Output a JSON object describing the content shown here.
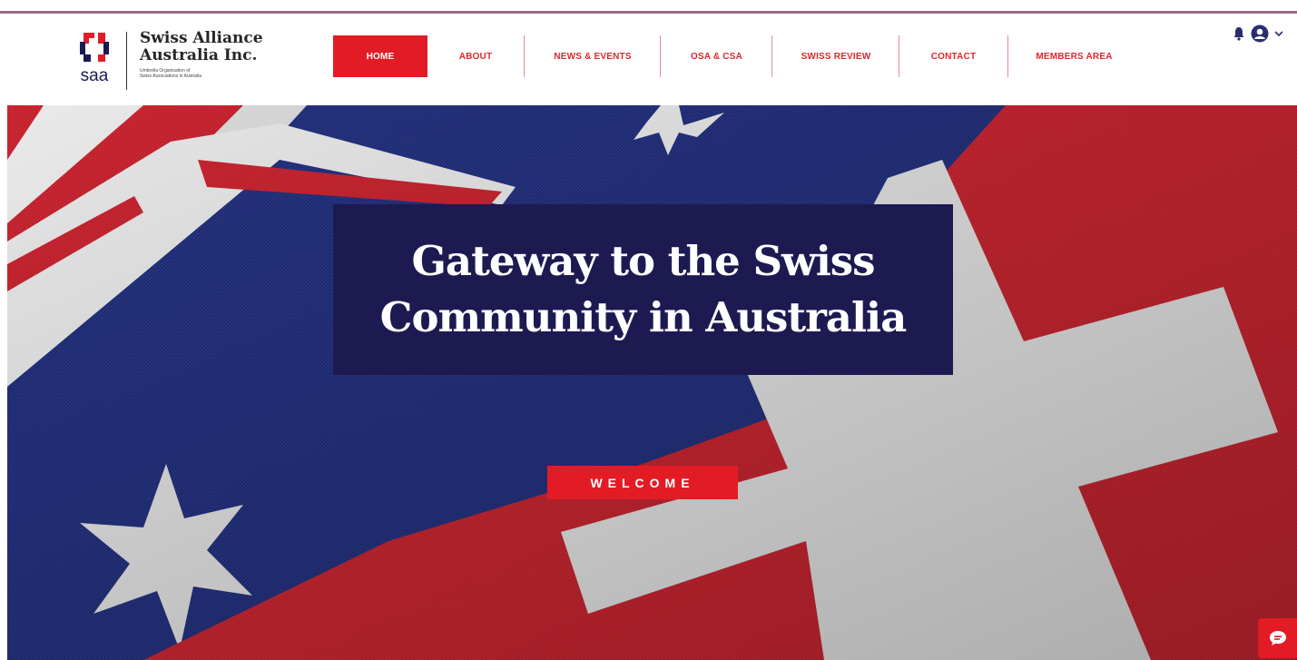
{
  "header": {
    "org_name_line1": "Swiss Alliance",
    "org_name_line2": "Australia Inc.",
    "logo_text": "saa",
    "tagline_line1": "Umbrella Organisation of",
    "tagline_line2": "Swiss Associations in Australia"
  },
  "nav": {
    "items": [
      {
        "label": "HOME",
        "active": true
      },
      {
        "label": "ABOUT",
        "active": false
      },
      {
        "label": "NEWS & EVENTS",
        "active": false
      },
      {
        "label": "OSA & CSA",
        "active": false
      },
      {
        "label": "SWISS REVIEW",
        "active": false
      },
      {
        "label": "CONTACT",
        "active": false
      },
      {
        "label": "MEMBERS AREA",
        "active": false
      }
    ]
  },
  "user_area": {
    "icons": [
      "bell-icon",
      "avatar-icon",
      "chevron-down-icon"
    ]
  },
  "hero": {
    "title_line1": "Gateway to the Swiss",
    "title_line2": "Community in Australia",
    "button_label": "WELCOME"
  },
  "chat": {
    "icon": "chat-icon"
  },
  "colors": {
    "brand_red": "#e31b25",
    "navy": "#1d1a52",
    "top_rule": "#9b6a8e"
  }
}
